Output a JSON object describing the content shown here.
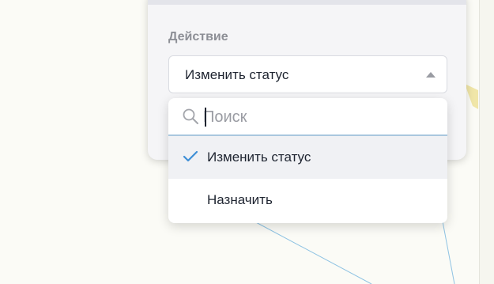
{
  "panel": {
    "field_label": "Действие",
    "select_value": "Изменить статус"
  },
  "dropdown": {
    "search_placeholder": "Поиск",
    "options": [
      {
        "label": "Изменить статус",
        "selected": true
      },
      {
        "label": "Назначить",
        "selected": false
      }
    ]
  },
  "colors": {
    "check": "#3f8fd6",
    "search_underline": "#a9c7de",
    "canvas_line": "#8fc3e3",
    "canvas_accent": "#f0e6a8"
  },
  "icons": [
    "search-icon",
    "checkmark-icon",
    "chevron-up-icon"
  ]
}
